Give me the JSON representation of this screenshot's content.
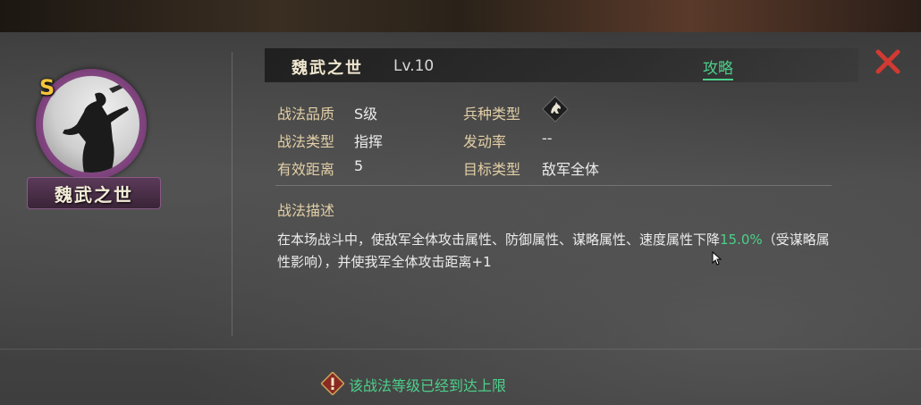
{
  "skill": {
    "name": "魏武之世",
    "level": "Lv.10",
    "guide_label": "攻略",
    "grade_badge": "S"
  },
  "attributes": [
    {
      "label": "战法品质",
      "value": "S级"
    },
    {
      "label": "战法类型",
      "value": "指挥"
    },
    {
      "label": "有效距离",
      "value": "5"
    },
    {
      "label": "兵种类型",
      "value": "",
      "icon": "horse-unit-icon"
    },
    {
      "label": "发动率",
      "value": "--"
    },
    {
      "label": "目标类型",
      "value": "敌军全体"
    }
  ],
  "description": {
    "heading": "战法描述",
    "text_before": "在本场战斗中，使敌军全体攻击属性、防御属性、谋略属性、速度属性下降",
    "highlight": "15.0%",
    "text_after": "（受谋略属性影响），并使我军全体攻击距离+1"
  },
  "notice": "该战法等级已经到达上限",
  "colors": {
    "accent_green": "#4cd08a",
    "label_gold": "#e2cfa6",
    "close_red": "#d03a32",
    "portrait_ring": "#8a4a88"
  }
}
